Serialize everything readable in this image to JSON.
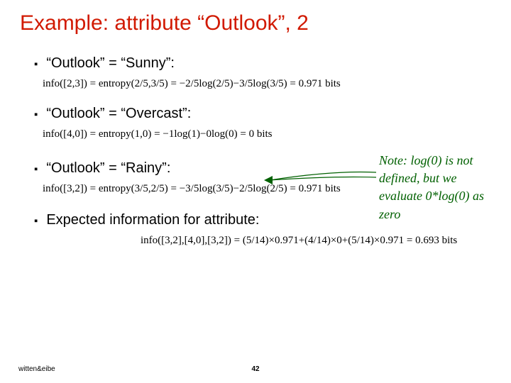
{
  "title": "Example: attribute “Outlook”, 2",
  "sunny": {
    "label": "“Outlook” = “Sunny”:",
    "formula": "info([2,3]) = entropy(2/5,3/5) = −2/5log(2/5)−3/5log(3/5) = 0.971 bits"
  },
  "overcast": {
    "label": "“Outlook” = “Overcast”:",
    "formula": "info([4,0]) = entropy(1,0) = −1log(1)−0log(0) = 0 bits"
  },
  "rainy": {
    "label": "“Outlook” = “Rainy”:",
    "formula": "info([3,2]) = entropy(3/5,2/5) = −3/5log(3/5)−2/5log(2/5) = 0.971 bits"
  },
  "expected": {
    "label": "Expected information for attribute:",
    "formula": "info([3,2],[4,0],[3,2]) = (5/14)×0.971+(4/14)×0+(5/14)×0.971 = 0.693 bits"
  },
  "note": "Note: log(0) is not defined, but we evaluate 0*log(0) as zero",
  "footer": {
    "author": "witten&eibe",
    "page": "42"
  }
}
